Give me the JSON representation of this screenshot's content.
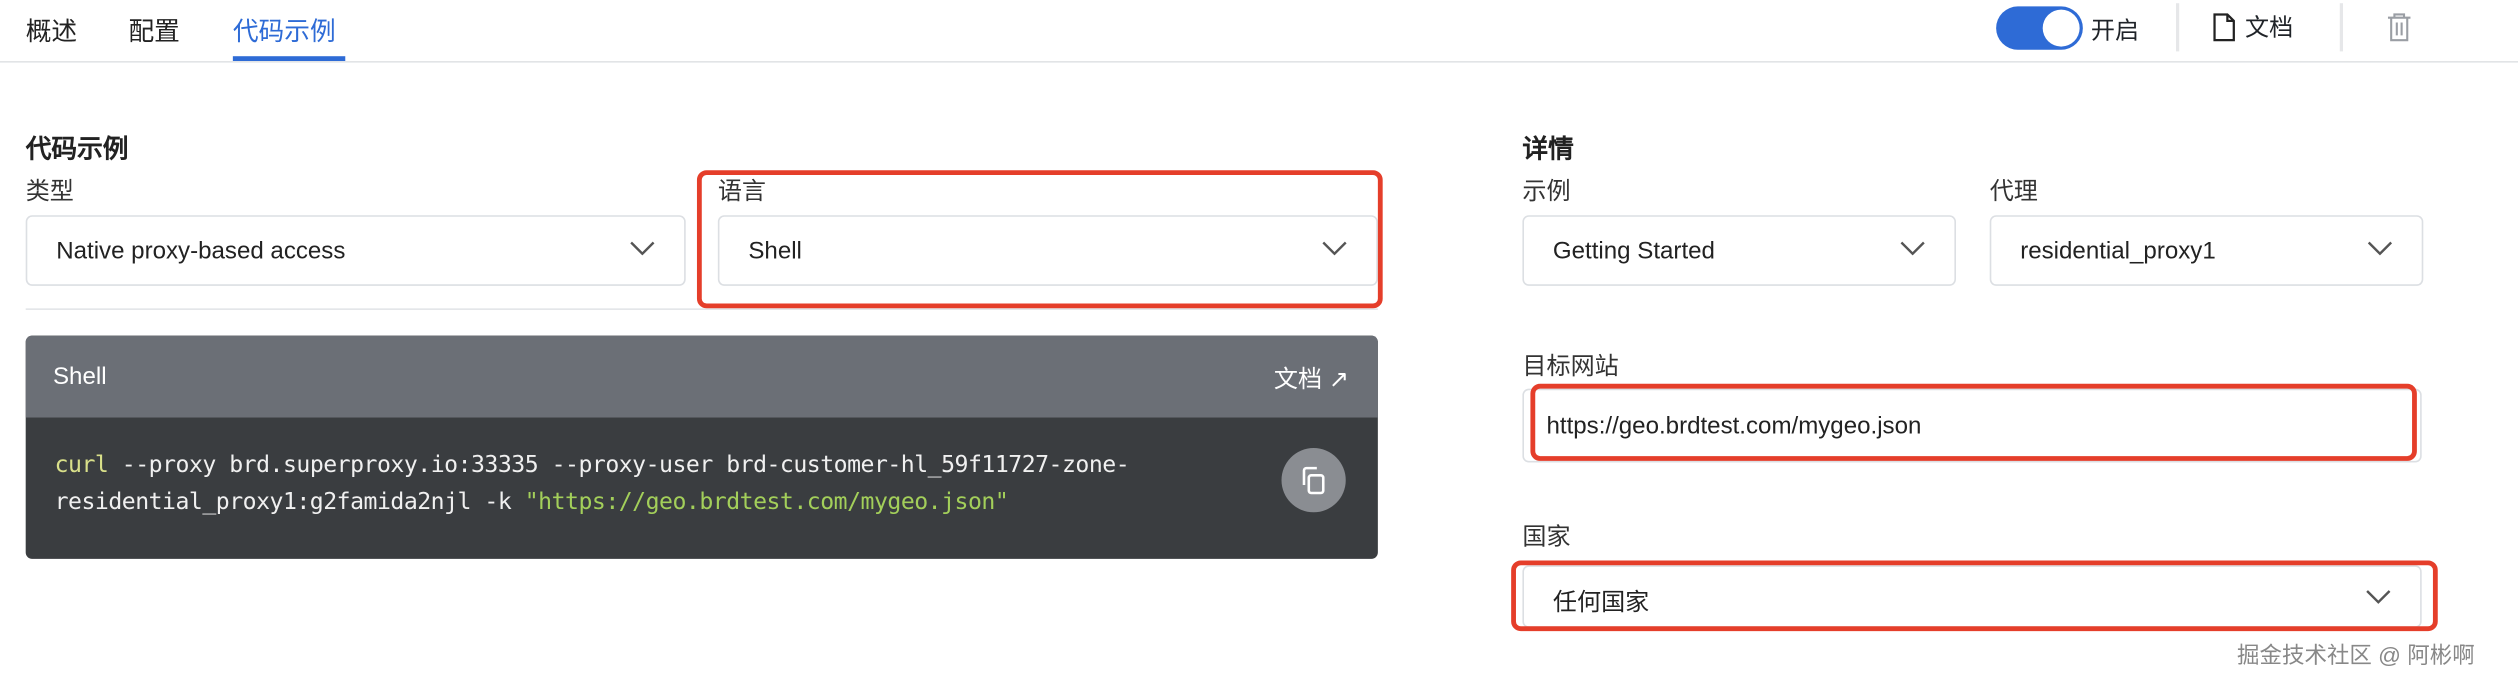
{
  "tabs": [
    {
      "label": "概述",
      "active": false
    },
    {
      "label": "配置",
      "active": false
    },
    {
      "label": "代码示例",
      "active": true
    }
  ],
  "toolbar": {
    "toggle_label": "开启",
    "toggle_on": true,
    "docs_label": "文档"
  },
  "left": {
    "heading": "代码示例",
    "type_label": "类型",
    "type_value": "Native proxy-based access",
    "language_label": "语言",
    "language_value": "Shell",
    "code_block": {
      "title": "Shell",
      "docs_link": "文档 ↗",
      "line1_cmd": "curl",
      "line1_rest": " --proxy brd.superproxy.io:33335 --proxy-user brd-customer-hl_59f11727-zone-",
      "line2_rest": "residential_proxy1:g2famida2njl -k ",
      "line2_string": "\"https://geo.brdtest.com/mygeo.json\""
    }
  },
  "right": {
    "heading": "详情",
    "example_label": "示例",
    "example_value": "Getting Started",
    "proxy_label": "代理",
    "proxy_value": "residential_proxy1",
    "target_label": "目标网站",
    "target_value": "https://geo.brdtest.com/mygeo.json",
    "country_label": "国家",
    "country_value": "任何国家"
  },
  "watermark": "掘金技术社区 @ 阿彬啊",
  "colors": {
    "accent": "#2e6bd6",
    "highlight": "#e53e2a",
    "code_bg": "#3a3d40",
    "code_header": "#6b6f76"
  }
}
